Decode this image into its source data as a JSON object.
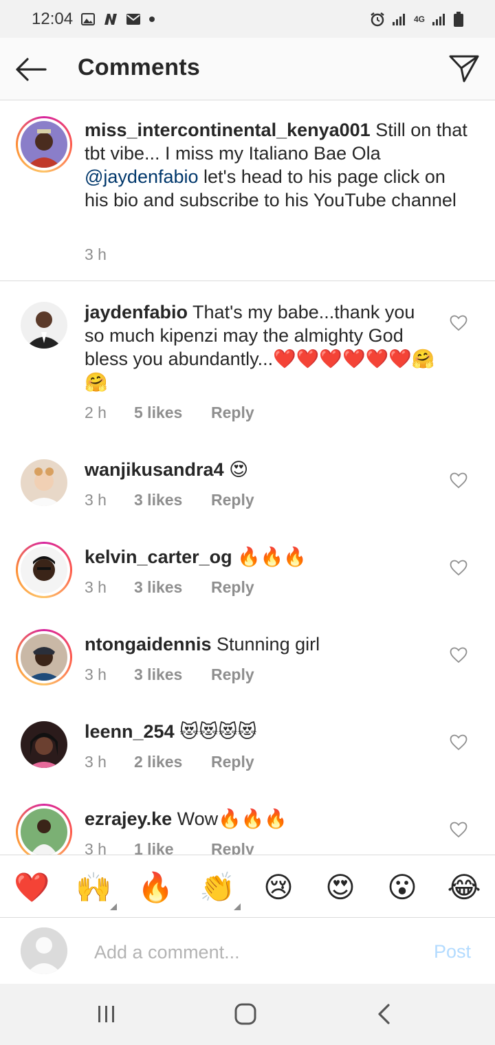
{
  "status_bar": {
    "time": "12:04",
    "left_icons": [
      "image-icon",
      "n-icon",
      "mail-icon",
      "dot-icon"
    ],
    "right_icons": [
      "alarm-icon",
      "signal-icon",
      "4g-icon",
      "signal-icon",
      "battery-icon"
    ],
    "network_label": "4G"
  },
  "header": {
    "title": "Comments"
  },
  "caption": {
    "username": "miss_intercontinental_kenya001",
    "text_before_mention": " Still on that tbt vibe... I miss my Italiano Bae Ola ",
    "mention": "@jaydenfabio",
    "text_after_mention": " let's head to his page click on his bio and subscribe to his YouTube channel",
    "time": "3 h"
  },
  "comments": [
    {
      "username": "jaydenfabio",
      "text": " That's my babe...thank you so much kipenzi may the almighty God bless you abundantly...❤️❤️❤️❤️❤️❤️🤗🤗",
      "time": "2 h",
      "likes": "5 likes",
      "reply": "Reply"
    },
    {
      "username": "wanjikusandra4",
      "text": " 😍",
      "time": "3 h",
      "likes": "3 likes",
      "reply": "Reply"
    },
    {
      "username": "kelvin_carter_og",
      "text": " 🔥🔥🔥",
      "time": "3 h",
      "likes": "3 likes",
      "reply": "Reply"
    },
    {
      "username": "ntongaidennis",
      "text": " Stunning girl",
      "time": "3 h",
      "likes": "3 likes",
      "reply": "Reply"
    },
    {
      "username": "leenn_254",
      "text": " 😻😻😻😻",
      "time": "3 h",
      "likes": "2 likes",
      "reply": "Reply"
    },
    {
      "username": "ezrajey.ke",
      "text": " Wow🔥🔥🔥",
      "time": "3 h",
      "likes": "1 like",
      "reply": "Reply"
    }
  ],
  "emoji_bar": [
    "❤️",
    "🙌",
    "🔥",
    "👏",
    "😢",
    "😍",
    "😮",
    "😂"
  ],
  "composer": {
    "placeholder": "Add a comment...",
    "post_label": "Post"
  },
  "colors": {
    "mention": "#00376b",
    "post_disabled": "#b3dbff",
    "meta_gray": "#8e8e8e"
  }
}
